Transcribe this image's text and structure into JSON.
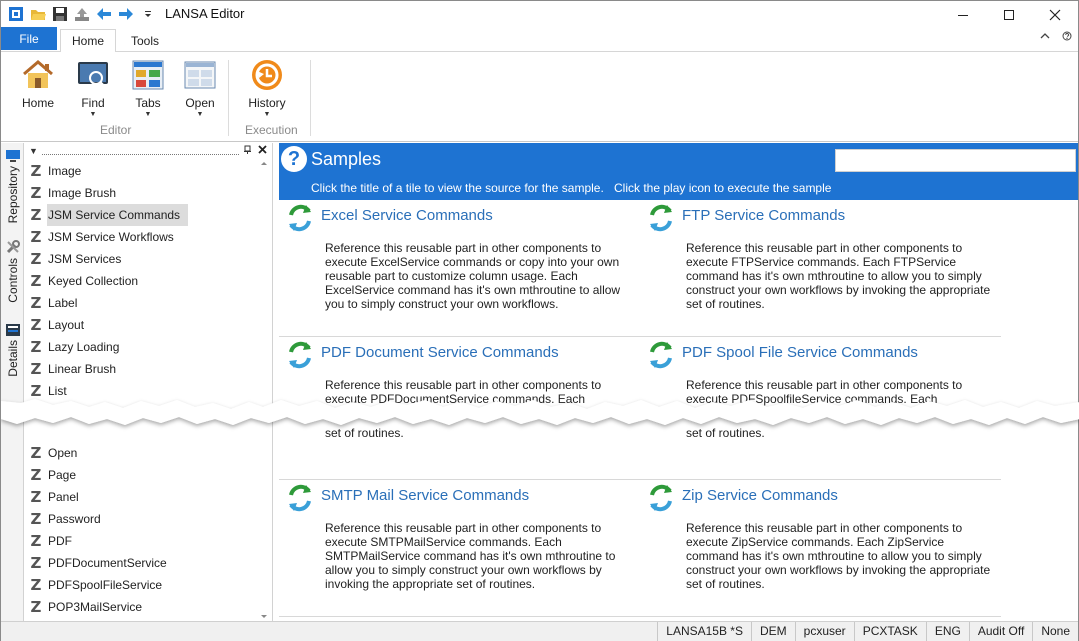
{
  "window": {
    "title": "LANSA Editor"
  },
  "quick_access": [
    "app-icon",
    "open-folder-icon",
    "save-icon",
    "upload-icon",
    "back-arrow-icon",
    "forward-arrow-icon",
    "customize-dropdown-icon"
  ],
  "ribbon_tabs": {
    "file": "File",
    "home": "Home",
    "tools": "Tools"
  },
  "ribbon": {
    "buttons": [
      {
        "label": "Home",
        "icon": "home-icon"
      },
      {
        "label": "Find",
        "icon": "find-icon"
      },
      {
        "label": "Tabs",
        "icon": "tabs-icon"
      },
      {
        "label": "Open",
        "icon": "open-icon"
      },
      {
        "label": "History",
        "icon": "history-icon"
      }
    ],
    "groups": {
      "editor": "Editor",
      "execution": "Execution"
    }
  },
  "side_tabs": {
    "repository": "Repository",
    "controls": "Controls",
    "details": "Details"
  },
  "left_list_top": [
    "Image",
    "Image Brush",
    "JSM Service Commands",
    "JSM Service Workflows",
    "JSM Services",
    "Keyed Collection",
    "Label",
    "Layout",
    "Lazy Loading",
    "Linear Brush",
    "List"
  ],
  "left_list_bottom": [
    "Open",
    "Page",
    "Panel",
    "Password",
    "PDF",
    "PDFDocumentService",
    "PDFSpoolFileService",
    "POP3MailService"
  ],
  "selected_item": "JSM Service Commands",
  "samples": {
    "title": "Samples",
    "hint_title": "Click the title of a tile to view the source for the sample.",
    "hint_play": "Click the play icon to execute the sample",
    "tiles": [
      {
        "title": "Excel Service Commands",
        "desc": "Reference this reusable part in other components to execute ExcelService commands or copy into your own reusable part to customize column usage.  Each ExcelService command has it's own mthroutine to allow you to simply construct your own workflows."
      },
      {
        "title": "FTP Service Commands",
        "desc": "Reference this reusable part in other components to execute FTPService commands.  Each FTPService command has it's own mthroutine to allow you to simply construct your own workflows by invoking the appropriate set of routines."
      },
      {
        "title": "PDF Document Service Commands",
        "desc_top": "Reference this reusable part in other components to execute PDFDocumentService commands.  Each",
        "desc_bottom": "set of routines."
      },
      {
        "title": "PDF Spool File Service Commands",
        "desc_top": "Reference this reusable part in other components to execute PDFSpoolfileService commands.  Each",
        "desc_bottom": "set of routines."
      },
      {
        "title": "SMTP Mail Service Commands",
        "desc": "Reference this reusable part in other components to execute SMTPMailService commands.  Each SMTPMailService command has it's own mthroutine to allow you to simply construct your own workflows by invoking the appropriate set of routines."
      },
      {
        "title": "Zip Service Commands",
        "desc": "Reference this reusable part in other components to execute ZipService commands.  Each ZipService command has it's own mthroutine to allow you to simply construct your own workflows by invoking the appropriate set of routines."
      }
    ]
  },
  "status_bar": [
    "LANSA15B *S",
    "DEM",
    "pcxuser",
    "PCXTASK",
    "ENG",
    "Audit Off",
    "None"
  ]
}
